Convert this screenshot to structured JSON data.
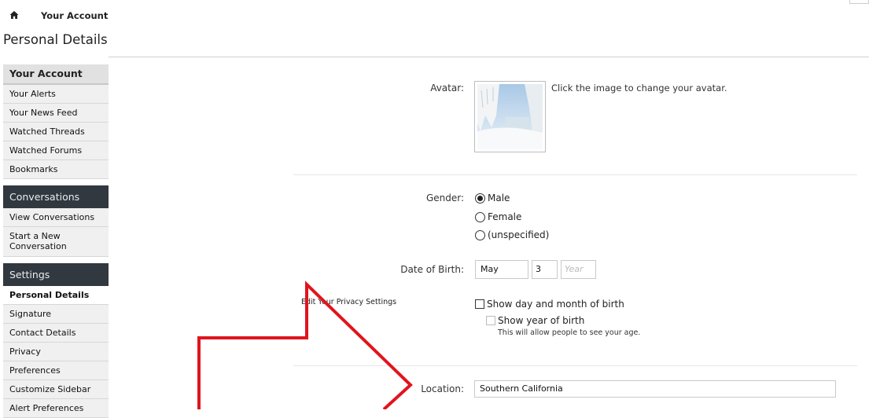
{
  "breadcrumb": {
    "home_icon": "home-icon",
    "current": "Your Account"
  },
  "page": {
    "title": "Personal Details"
  },
  "sidebar": {
    "sections": [
      {
        "title": "Your Account",
        "items": [
          "Your Alerts",
          "Your News Feed",
          "Watched Threads",
          "Watched Forums",
          "Bookmarks"
        ]
      },
      {
        "title": "Conversations",
        "items": [
          "View Conversations",
          "Start a New Conversation"
        ]
      },
      {
        "title": "Settings",
        "items": [
          "Personal Details",
          "Signature",
          "Contact Details",
          "Privacy",
          "Preferences",
          "Customize Sidebar",
          "Alert Preferences"
        ]
      }
    ],
    "active_item": "Personal Details"
  },
  "form": {
    "avatar": {
      "label": "Avatar:",
      "note": "Click the image to change your avatar."
    },
    "gender": {
      "label": "Gender:",
      "options": [
        "Male",
        "Female",
        "(unspecified)"
      ],
      "selected": "Male"
    },
    "dob": {
      "label": "Date of Birth:",
      "month": "May",
      "day": "3",
      "year_placeholder": "Year"
    },
    "privacy": {
      "link": "Edit Your Privacy Settings",
      "show_day_month": "Show day and month of birth",
      "show_year": "Show year of birth",
      "hint": "This will allow people to see your age."
    },
    "location": {
      "label": "Location:",
      "value": "Southern California"
    }
  },
  "colors": {
    "annotation_arrow": "#e0141e",
    "sidebar_dark": "#323840"
  }
}
